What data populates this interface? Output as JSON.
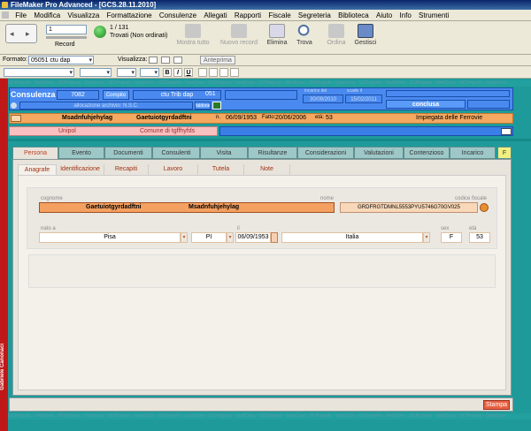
{
  "window": {
    "title": "FileMaker Pro Advanced - [GCS.28.11.2010]"
  },
  "menu": [
    "File",
    "Modifica",
    "Visualizza",
    "Formattazione",
    "Consulenze",
    "Allegati",
    "Rapporti",
    "Fiscale",
    "Segreteria",
    "Biblioteca",
    "Aiuto",
    "Info",
    "Strumenti"
  ],
  "toolbar": {
    "record_label": "Record",
    "record_value": "1",
    "found_count": "1 / 131",
    "found_status": "Trovati (Non ordinati)",
    "mostra_tutto": "Mostra tutto",
    "nuovo_record": "Nuovo record",
    "elimina": "Elimina",
    "trova": "Trova",
    "ordina": "Ordina",
    "gestisci": "Gestisci"
  },
  "format_bar": {
    "formato_label": "Formato:",
    "formato_value": "05051 ctu dap",
    "visualizza_label": "Visualizza:",
    "anteprima": "Anteprima"
  },
  "format_bar2": {
    "bold": "B",
    "italic": "I",
    "underline": "U"
  },
  "stripe_text": "GCProjects · GestCons · GCProjects · GestCons · GCProjects · GestCons · GCProjects · GestCons · GCProjects · GestCons · GCProjects · GestCons · GCProjects · GestCons · GCProjects · GestCons · GCProjects · GestCons · GCProjects · GestCons",
  "header": {
    "consulenza_label": "Consulenza",
    "consulenza_number": "7082",
    "compito": "Compito",
    "tipo": "ctu Trib dap",
    "tipo_code": "051",
    "allocation": "allocazione archivio: N.S.C.",
    "incarico_del_label": "incarico del",
    "incarico_del": "30/09/2010",
    "scade_label": "scade il",
    "scade": "15/02/2011",
    "status": "conclusa",
    "small_tag": "faldone 1"
  },
  "person_bar": {
    "cognome": "Msadnfuhjehylag",
    "nome": "Gaetuiotgyrdadftni",
    "nato_label": "n.",
    "nato": "06/09/1953",
    "fatto_label": "Fatto:",
    "fatto": "20/06/2006",
    "eta_label": "età:",
    "eta": "53",
    "occupazione": "Impiegata delle Ferrovie"
  },
  "org_bar": {
    "org": "Unipol",
    "comune": "Comune di tgffhyfds"
  },
  "tabs": [
    "Persona",
    "Evento",
    "Documenti",
    "Consulenti",
    "Visita",
    "Risultanze",
    "Considerazioni",
    "Valutazioni",
    "Contenzioso",
    "Incarico",
    "F"
  ],
  "subtabs": [
    "Anagrafe",
    "Identificazione",
    "Recapiti",
    "Lavoro",
    "Tutela",
    "Note"
  ],
  "anagrafe": {
    "cognome_label": "cognome",
    "cognome": "Gaetuiotgyrdadftni",
    "nome_value": "Msadnfuhjehylag",
    "nome_label": "nome",
    "cf_label": "codice fiscale",
    "cf": "GRDFRGTDMNL5553PYU5746G70GV025",
    "nato_a_label": "nato a",
    "citta": "Pisa",
    "prov": "PI",
    "il_label": "il",
    "data": "06/09/1953",
    "paese": "Italia",
    "sex_label": "sex",
    "sex": "F",
    "eta_label": "età",
    "eta": "53"
  },
  "stampa": "Stampa",
  "side_label": "Gabriele Canonaci"
}
